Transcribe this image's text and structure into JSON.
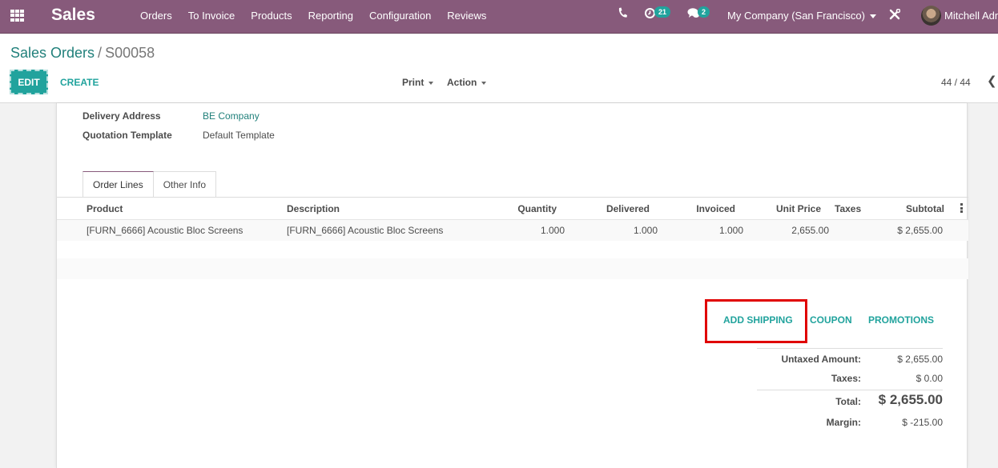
{
  "navbar": {
    "app_name": "Sales",
    "menu": [
      "Orders",
      "To Invoice",
      "Products",
      "Reporting",
      "Configuration",
      "Reviews"
    ],
    "activity_count": "21",
    "message_count": "2",
    "company": "My Company (San Francisco)",
    "user": "Mitchell Admin",
    "icons": [
      "apps-icon",
      "phone-icon",
      "activity-clock-icon",
      "chat-icon",
      "debug-tools-icon",
      "avatar"
    ]
  },
  "control_panel": {
    "breadcrumb_parent": "Sales Orders",
    "breadcrumb_sep": "/",
    "breadcrumb_current": "S00058",
    "edit_label": "EDIT",
    "create_label": "CREATE",
    "print_label": "Print",
    "action_label": "Action",
    "pager": "44 / 44"
  },
  "form": {
    "fields": [
      {
        "label": "Delivery Address",
        "value": "BE Company"
      },
      {
        "label": "Quotation Template",
        "value": "Default Template"
      }
    ],
    "tabs": [
      "Order Lines",
      "Other Info"
    ],
    "active_tab": "Order Lines"
  },
  "order_lines": {
    "columns": [
      "Product",
      "Description",
      "Quantity",
      "Delivered",
      "Invoiced",
      "Unit Price",
      "Taxes",
      "Subtotal"
    ],
    "rows": [
      {
        "product": "[FURN_6666] Acoustic Bloc Screens",
        "description": "[FURN_6666] Acoustic Bloc Screens",
        "quantity": "1.000",
        "delivered": "1.000",
        "invoiced": "1.000",
        "unit_price": "2,655.00",
        "taxes": "",
        "subtotal": "$ 2,655.00"
      }
    ]
  },
  "buttons": {
    "add_shipping": "ADD SHIPPING",
    "coupon": "COUPON",
    "promotions": "PROMOTIONS"
  },
  "totals": {
    "untaxed_label": "Untaxed Amount:",
    "untaxed_value": "$ 2,655.00",
    "taxes_label": "Taxes:",
    "taxes_value": "$ 0.00",
    "total_label": "Total:",
    "total_value": "$ 2,655.00",
    "margin_label": "Margin:",
    "margin_value": "$ -215.00"
  },
  "colors": {
    "navbar": "#875a7b",
    "primary": "#21a39d",
    "link": "#21807b",
    "highlight": "#e00000"
  }
}
